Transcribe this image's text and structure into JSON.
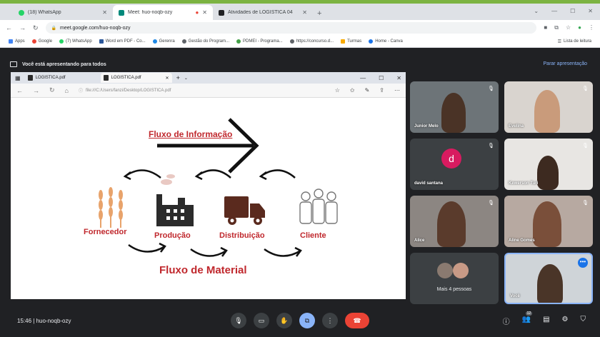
{
  "browser": {
    "tabs": [
      {
        "title": "(18) WhatsApp",
        "color": "#25d366"
      },
      {
        "title": "Meet: huo-noqb-ozy",
        "color": "#00897b"
      },
      {
        "title": "Atividades de LOGÍSTICA 04",
        "color": "#202124"
      }
    ],
    "url": "meet.google.com/huo-noqb-ozy",
    "bookmarks": [
      "Apps",
      "Google",
      "(7) WhatsApp",
      "Word em PDF - Co...",
      "Gerenra",
      "Gestão do Program...",
      "PDMEI - Programa...",
      "https://concurso.d...",
      "Turmas",
      "Home - Canva"
    ],
    "bookmarks_right": "Lista de leitura"
  },
  "meet": {
    "presenting_text": "Você está apresentando para todos",
    "stop_label": "Parar apresentação",
    "time": "15:46",
    "meeting_code": "huo-noqb-ozy"
  },
  "shared": {
    "tab1": "LOGISTICA.pdf",
    "tab2": "LOGISTICA.pdf",
    "url": "file:///C:/Users/fanzi/Desktop/LOGISTICA.pdf"
  },
  "slide": {
    "fluxo_info": "Fluxo de Informação",
    "fluxo_material": "Fluxo de Material",
    "stages": [
      "Fornecedor",
      "Produção",
      "Distribuição",
      "Cliente"
    ]
  },
  "participants": [
    {
      "name": "Junior Melo"
    },
    {
      "name": "Evelina"
    },
    {
      "name": "david santana",
      "initial": "d"
    },
    {
      "name": "Kewerson Turi"
    },
    {
      "name": "Alice"
    },
    {
      "name": "Aline Gomes"
    },
    {
      "name": "Mais 4 pessoas"
    },
    {
      "name": "Você"
    }
  ],
  "people_count": "12"
}
